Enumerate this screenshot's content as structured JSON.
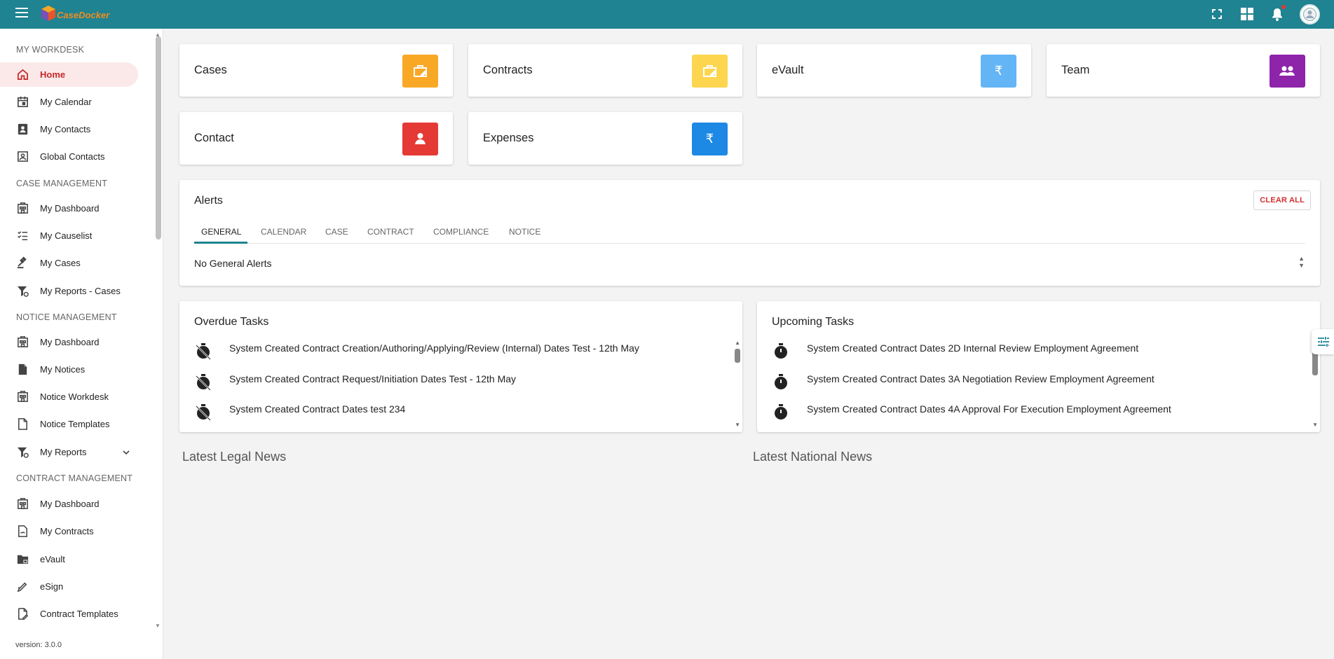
{
  "header": {
    "logo_text": "CaseDocker",
    "icons": [
      "menu-icon",
      "fullscreen-icon",
      "apps-grid-icon",
      "notifications-icon",
      "avatar"
    ]
  },
  "sidebar": {
    "sections": {
      "workdesk": "MY WORKDESK",
      "case": "CASE MANAGEMENT",
      "notice": "NOTICE MANAGEMENT",
      "contract": "CONTRACT MANAGEMENT"
    },
    "items": [
      {
        "label": "Home",
        "icon": "home-icon",
        "active": true
      },
      {
        "label": "My Calendar",
        "icon": "calendar-icon"
      },
      {
        "label": "My Contacts",
        "icon": "contacts-icon"
      },
      {
        "label": "Global Contacts",
        "icon": "global-contacts-icon"
      },
      {
        "label": "My Dashboard",
        "icon": "dashboard-icon"
      },
      {
        "label": "My Causelist",
        "icon": "causelist-icon"
      },
      {
        "label": "My Cases",
        "icon": "gavel-icon"
      },
      {
        "label": "My Reports - Cases",
        "icon": "filter-settings-icon"
      },
      {
        "label": "My Dashboard",
        "icon": "dashboard-icon"
      },
      {
        "label": "My Notices",
        "icon": "notice-icon"
      },
      {
        "label": "Notice Workdesk",
        "icon": "dashboard-icon"
      },
      {
        "label": "Notice Templates",
        "icon": "file-icon"
      },
      {
        "label": "My Reports",
        "icon": "filter-settings-icon"
      },
      {
        "label": "My Dashboard",
        "icon": "dashboard-icon"
      },
      {
        "label": "My Contracts",
        "icon": "contract-icon"
      },
      {
        "label": "eVault",
        "icon": "folder-lock-icon"
      },
      {
        "label": "eSign",
        "icon": "signature-icon"
      },
      {
        "label": "Contract Templates",
        "icon": "file-edit-icon"
      }
    ],
    "version": "version: 3.0.0"
  },
  "tiles": [
    {
      "label": "Cases",
      "color": "#f9a825",
      "icon": "briefcase-edit-icon"
    },
    {
      "label": "Contracts",
      "color": "#fdd54f",
      "icon": "briefcase-edit-icon"
    },
    {
      "label": "eVault",
      "color": "#64b5f6",
      "icon": "rupee-icon"
    },
    {
      "label": "Team",
      "color": "#8e24aa",
      "icon": "team-icon"
    },
    {
      "label": "Contact",
      "color": "#e53935",
      "icon": "contact-icon"
    },
    {
      "label": "Expenses",
      "color": "#1e88e5",
      "icon": "rupee-icon"
    }
  ],
  "alerts": {
    "title": "Alerts",
    "clear_label": "CLEAR ALL",
    "tabs": [
      "GENERAL",
      "CALENDAR",
      "CASE",
      "CONTRACT",
      "COMPLIANCE",
      "NOTICE"
    ],
    "active_tab": "GENERAL",
    "empty_text": "No General Alerts"
  },
  "overdue": {
    "title": "Overdue Tasks",
    "items": [
      "System Created Contract Creation/Authoring/Applying/Review (Internal) Dates Test - 12th May",
      "System Created Contract Request/Initiation Dates Test - 12th May",
      "System Created Contract Dates test 234"
    ]
  },
  "upcoming": {
    "title": "Upcoming Tasks",
    "items": [
      "System Created Contract Dates 2D Internal Review Employment Agreement",
      "System Created Contract Dates 3A Negotiation Review Employment Agreement",
      "System Created Contract Dates 4A Approval For Execution Employment Agreement"
    ]
  },
  "news": {
    "legal": "Latest Legal News",
    "national": "Latest National News"
  },
  "colors": {
    "topbar": "#1f8391",
    "accent_red": "#c62828",
    "active_bg": "#fbe9ea"
  }
}
